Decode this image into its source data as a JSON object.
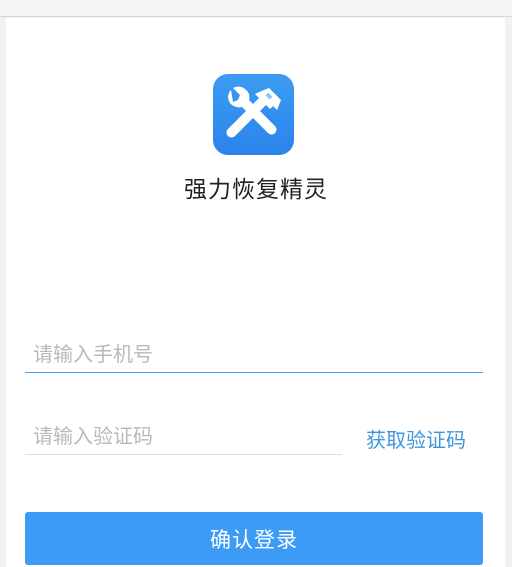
{
  "app": {
    "name": "强力恢复精灵",
    "icon": "wrench-hammer-icon",
    "accent_color": "#3c9cf5"
  },
  "login": {
    "phone_placeholder": "请输入手机号",
    "code_placeholder": "请输入验证码",
    "get_code_label": "获取验证码",
    "submit_label": "确认登录"
  }
}
